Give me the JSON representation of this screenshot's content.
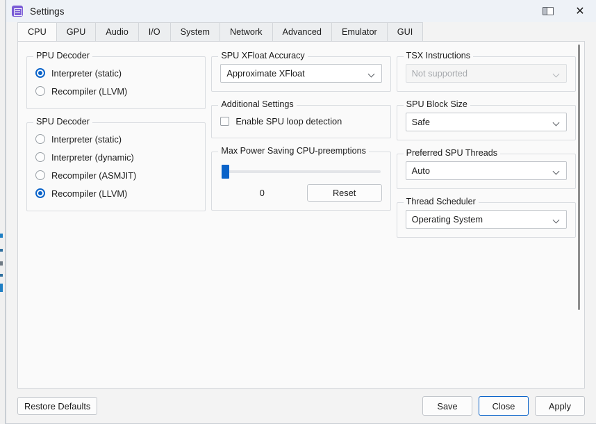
{
  "window": {
    "title": "Settings",
    "icon": "settings-app-icon",
    "snap_icon": "snap-layouts-icon",
    "close_icon": "close-icon"
  },
  "tabs": [
    {
      "label": "CPU",
      "active": true
    },
    {
      "label": "GPU",
      "active": false
    },
    {
      "label": "Audio",
      "active": false
    },
    {
      "label": "I/O",
      "active": false
    },
    {
      "label": "System",
      "active": false
    },
    {
      "label": "Network",
      "active": false
    },
    {
      "label": "Advanced",
      "active": false
    },
    {
      "label": "Emulator",
      "active": false
    },
    {
      "label": "GUI",
      "active": false
    }
  ],
  "column1": {
    "ppu_decoder": {
      "legend": "PPU Decoder",
      "options": [
        {
          "label": "Interpreter (static)",
          "selected": true
        },
        {
          "label": "Recompiler (LLVM)",
          "selected": false
        }
      ]
    },
    "spu_decoder": {
      "legend": "SPU Decoder",
      "options": [
        {
          "label": "Interpreter (static)",
          "selected": false
        },
        {
          "label": "Interpreter (dynamic)",
          "selected": false
        },
        {
          "label": "Recompiler (ASMJIT)",
          "selected": false
        },
        {
          "label": "Recompiler (LLVM)",
          "selected": true
        }
      ]
    }
  },
  "column2": {
    "spu_xfloat": {
      "legend": "SPU XFloat Accuracy",
      "value": "Approximate XFloat"
    },
    "additional_settings": {
      "legend": "Additional Settings",
      "checkbox_label": "Enable SPU loop detection",
      "checked": false
    },
    "max_power_saving": {
      "legend": "Max Power Saving CPU-preemptions",
      "value": "0",
      "slider_percent": 0,
      "reset_label": "Reset"
    }
  },
  "column3": {
    "tsx": {
      "legend": "TSX Instructions",
      "value": "Not supported",
      "disabled": true
    },
    "spu_block_size": {
      "legend": "SPU Block Size",
      "value": "Safe"
    },
    "preferred_spu_threads": {
      "legend": "Preferred SPU Threads",
      "value": "Auto"
    },
    "thread_scheduler": {
      "legend": "Thread Scheduler",
      "value": "Operating System"
    }
  },
  "footer": {
    "restore_defaults": "Restore Defaults",
    "save": "Save",
    "close": "Close",
    "apply": "Apply"
  },
  "colors": {
    "accent": "#0a63c9",
    "titlebar_bg": "#eef2f7",
    "panel_bg": "#fafafa",
    "window_bg": "#f3f3f3",
    "icon_purple": "#7a5cd6"
  }
}
